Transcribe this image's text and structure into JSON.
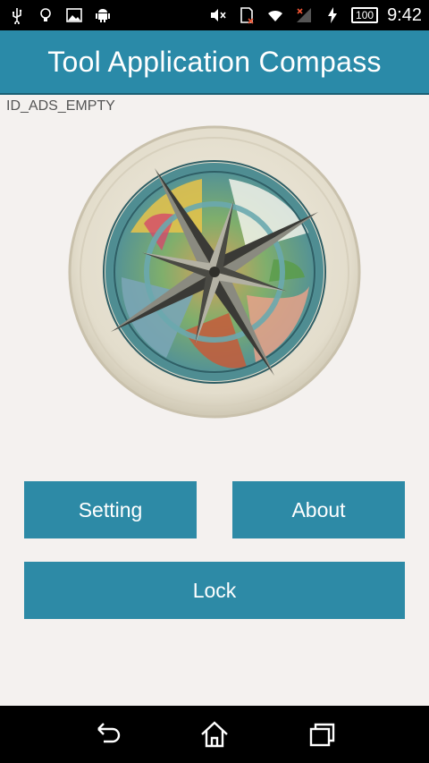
{
  "status_bar": {
    "icons_left": [
      "usb-icon",
      "bulb-icon",
      "image-icon",
      "android-icon"
    ],
    "icons_right": [
      "mute-icon",
      "sim-icon",
      "wifi-icon",
      "signal-icon",
      "charging-icon"
    ],
    "battery": "100",
    "time": "9:42"
  },
  "action_bar": {
    "title": "Tool Application Compass",
    "color": "#2a8aa8"
  },
  "ads": {
    "text": "ID_ADS_EMPTY"
  },
  "buttons": {
    "setting": "Setting",
    "about": "About",
    "lock": "Lock",
    "color": "#2d8aa6"
  },
  "nav_bar": {
    "items": [
      "back-icon",
      "home-icon",
      "recent-apps-icon"
    ]
  }
}
